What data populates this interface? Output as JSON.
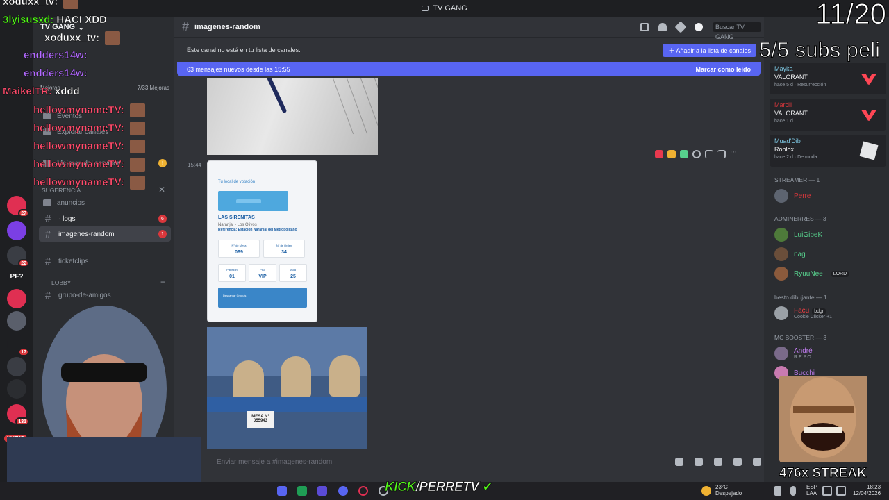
{
  "window": {
    "title": "TV GANG"
  },
  "server": {
    "name": "TV GANG",
    "boost_label": "Mejoras",
    "boost_progress": "7/33 Mejoras",
    "rail_badges": [
      "27",
      "22",
      "17",
      "131"
    ],
    "rail_labels": [
      "PF?"
    ],
    "new_label": "NUEVO"
  },
  "sidebar": {
    "items": [
      {
        "label": "Eventos"
      },
      {
        "label": "Explorar canales"
      },
      {
        "label": "Mejoras del servidor"
      }
    ],
    "suggestion_label": "Sugerencia",
    "channels": [
      {
        "label": "anuncios",
        "state": "normal"
      },
      {
        "label": "· logs",
        "state": "unread",
        "count": "6"
      },
      {
        "label": "imagenes-random",
        "state": "active",
        "count": "1"
      },
      {
        "label": "ticketclips",
        "state": "normal"
      }
    ],
    "category": "LOBBY",
    "lobby_channel": "grupo-de-amigos"
  },
  "channel": {
    "name": "imagenes-random",
    "notice": "Este canal no está en tu lista de canales.",
    "add_button": "Añadir a la lista de canales",
    "new_messages": "63 mensajes nuevos desde las 15:55",
    "mark_read": "Marcar como leído",
    "search_placeholder": "Buscar TV GANG",
    "composer_placeholder": "Enviar mensaje a #imagenes-random"
  },
  "messages": {
    "timestamp": "15:44",
    "voting_card": {
      "title": "Tu local de votación",
      "place": "LAS SIRENITAS",
      "district": "Naranjal - Los Olivos",
      "reference": "Referencia: Estación Naranjal del Metropolitano",
      "fields": [
        {
          "label": "N° de Mesa",
          "value": "069"
        },
        {
          "label": "N° de Orden",
          "value": "34"
        },
        {
          "label": "Pabellón",
          "value": "01"
        },
        {
          "label": "Piso",
          "value": "VIP"
        },
        {
          "label": "Aula",
          "value": "25"
        }
      ],
      "download": "Descargar Croquis"
    },
    "mesa_sign": "MESA N° 055943"
  },
  "members": {
    "activities": [
      {
        "name": "Mayka",
        "game": "VALORANT",
        "time": "hace 5 d",
        "extra": "Resurrección",
        "name_color": "#7ec8e3"
      },
      {
        "name": "Marcili",
        "game": "VALORANT",
        "time": "hace 1 d",
        "extra": "",
        "name_color": "#da373c"
      },
      {
        "name": "Muad'Dib",
        "game": "Roblox",
        "time": "hace 2 d",
        "extra": "De moda",
        "name_color": "#7ec8e3"
      }
    ],
    "groups": [
      {
        "label": "STREAMER — 1"
      },
      {
        "label": "ADMINERRES — 3"
      },
      {
        "label": "besto dibujante — 1"
      },
      {
        "label": "MC BOOSTER — 3"
      }
    ],
    "list": [
      {
        "name": "Perre",
        "color": "#da373c",
        "sub": "",
        "tag": ""
      },
      {
        "name": "LuiGibeK",
        "color": "#57d18d",
        "sub": "",
        "tag": ""
      },
      {
        "name": "nag",
        "color": "#57d18d",
        "sub": "",
        "tag": ""
      },
      {
        "name": "RyuuNee",
        "color": "#57d18d",
        "sub": "",
        "tag": "LORD"
      },
      {
        "name": "Facu",
        "color": "#f23f43",
        "sub": "Cookie Clicker +1",
        "tag": "bdgr"
      },
      {
        "name": "André",
        "color": "#c07cf0",
        "sub": "R.E.P.O.",
        "tag": ""
      },
      {
        "name": "Bucchi",
        "color": "#c07cf0",
        "sub": "",
        "tag": ""
      }
    ]
  },
  "taskbar": {
    "weather_temp": "23°C",
    "weather_desc": "Despejado",
    "lang": "ESP",
    "lang2": "LAA",
    "time": "18:23",
    "date": "12/04/2026"
  },
  "stream": {
    "counter": "11/20",
    "subs": "5/5 subs peli",
    "brand_a": "KICK",
    "brand_b": "/PERRETV",
    "streak": "476x STREAK",
    "chat": [
      {
        "user": "xoduxx_tv:",
        "text": "",
        "color": "#ffffff"
      },
      {
        "user": "3lyisusxd:",
        "text": "HACI XDD",
        "color": "#53fc18"
      },
      {
        "user": "xoduxx_tv:",
        "text": "",
        "color": "#ffffff"
      },
      {
        "user": "endders14w:",
        "text": "",
        "color": "#b36bff"
      },
      {
        "user": "endders14w:",
        "text": "",
        "color": "#b36bff"
      },
      {
        "user": "MaikelTR:",
        "text": "xddd",
        "color": "#ff4d6d"
      },
      {
        "user": "hellowmynameTV:",
        "text": "",
        "color": "#ff4d6d"
      },
      {
        "user": "hellowmynameTV:",
        "text": "",
        "color": "#ff4d6d"
      },
      {
        "user": "hellowmynameTV:",
        "text": "",
        "color": "#ff4d6d"
      },
      {
        "user": "hellowmynameTV:",
        "text": "",
        "color": "#ff4d6d"
      },
      {
        "user": "hellowmynameTV:",
        "text": "",
        "color": "#ff4d6d"
      }
    ]
  }
}
